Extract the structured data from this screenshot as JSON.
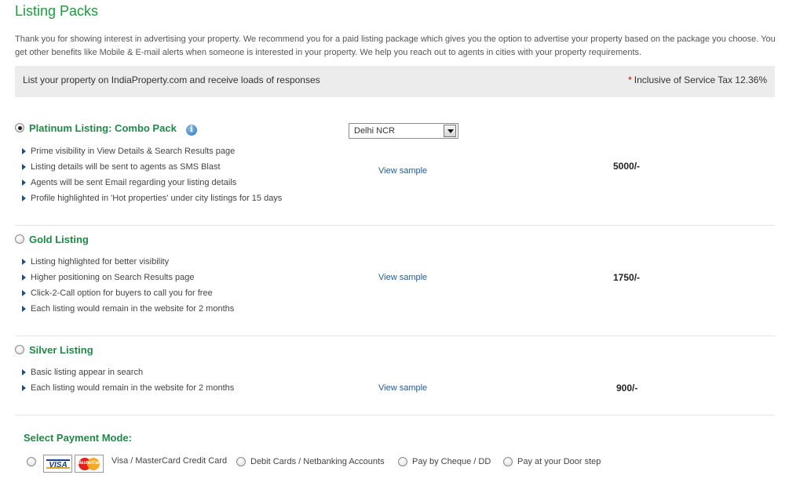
{
  "page_title": "Listing Packs",
  "intro": "Thank you for showing interest in advertising your property. We recommend you for a paid listing package which gives you the option to advertise your property based on the package you choose. You get other benefits like Mobile & E-mail alerts when someone is interested in your property. We help you reach out to agents in cities with your property requirements.",
  "banner": {
    "left": "List your property on IndiaProperty.com and receive loads of responses",
    "star": "*",
    "right": "Inclusive of Service Tax 12.36%"
  },
  "packs": [
    {
      "title": "Platinum Listing: Combo Pack",
      "selected": true,
      "info_icon": "info-icon",
      "city_select": "Delhi NCR",
      "features": [
        "Prime visibility in View Details & Search Results page",
        "Listing details will be sent to agents as SMS Blast",
        "Agents will be sent Email regarding your listing details",
        "Profile highlighted in 'Hot properties' under city listings for 15 days"
      ],
      "view_sample": "View sample",
      "price": "5000/-"
    },
    {
      "title": "Gold Listing",
      "selected": false,
      "features": [
        "Listing highlighted for better visibility",
        "Higher positioning on Search Results page",
        "Click-2-Call option for buyers to call you for free",
        "Each listing would remain in the website for 2 months"
      ],
      "view_sample": "View sample",
      "price": "1750/-"
    },
    {
      "title": "Silver Listing",
      "selected": false,
      "features": [
        "Basic listing appear in search",
        "Each listing would remain in the website for 2 months"
      ],
      "view_sample": "View sample",
      "price": "900/-"
    }
  ],
  "payment": {
    "heading": "Select Payment Mode:",
    "options": [
      {
        "label": "Visa / MasterCard Credit Card",
        "logos": [
          "VISA",
          "MasterCard"
        ],
        "selected": false
      },
      {
        "label": "Debit Cards / Netbanking Accounts",
        "selected": false
      },
      {
        "label": "Pay by Cheque / DD",
        "selected": false
      },
      {
        "label": "Pay at your Door step",
        "selected": false
      }
    ]
  }
}
